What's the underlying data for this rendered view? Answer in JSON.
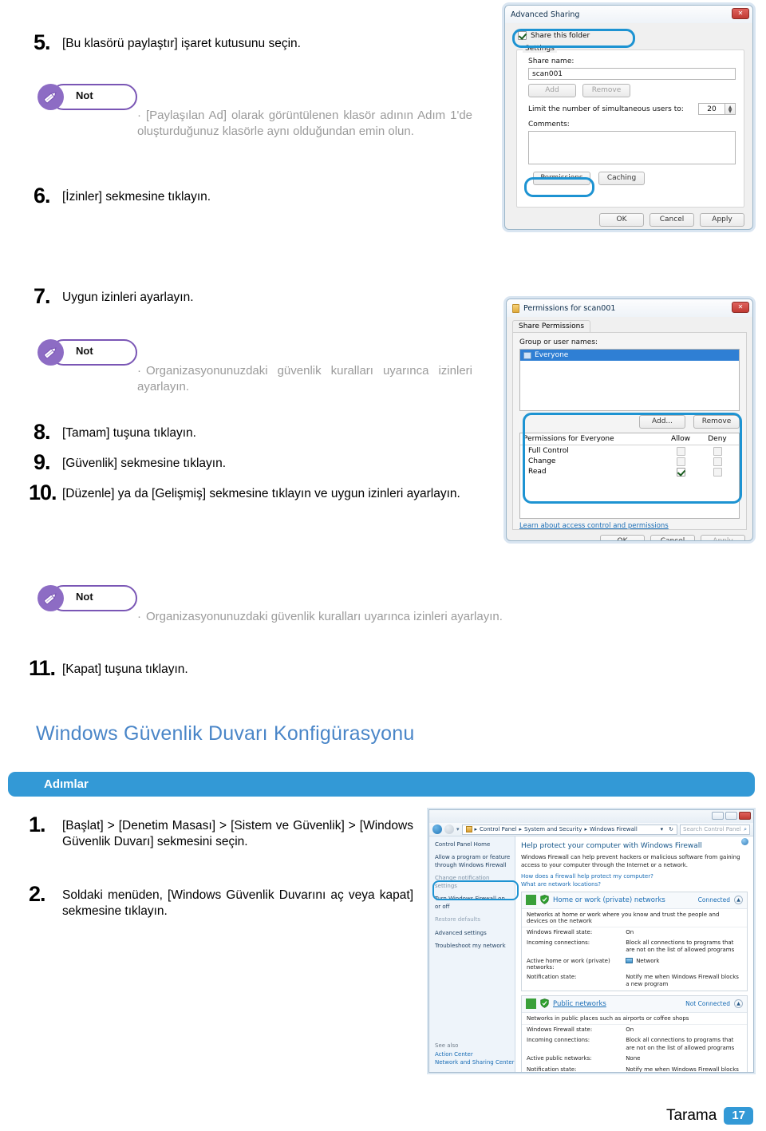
{
  "steps_top": [
    {
      "num": "5.",
      "text": "[Bu klasörü paylaştır] işaret kutusunu seçin."
    },
    {
      "num": "6.",
      "text": "[İzinler] sekmesine tıklayın."
    },
    {
      "num": "7.",
      "text": "Uygun izinleri ayarlayın."
    },
    {
      "num": "8.",
      "text": "[Tamam] tuşuna tıklayın."
    },
    {
      "num": "9.",
      "text": "[Güvenlik] sekmesine tıklayın."
    },
    {
      "num": "10.",
      "text": "[Düzenle] ya da [Gelişmiş] sekmesine tıklayın ve uygun izinleri ayarlayın."
    },
    {
      "num": "11.",
      "text": "[Kapat] tuşuna tıklayın."
    }
  ],
  "notes": {
    "label": "Not",
    "bullet": "·",
    "note1": "[Paylaşılan Ad] olarak görüntülenen klasör adının Adım 1'de oluşturduğunuz klasörle aynı olduğundan emin olun.",
    "note2": "Organizasyonunuzdaki güvenlik kuralları uyarınca izinleri ayarlayın.",
    "note3": "Organizasyonunuzdaki güvenlik kuralları uyarınca izinleri ayarlayın."
  },
  "section": {
    "heading": "Windows Güvenlik Duvarı Konfigürasyonu",
    "steps_bar_label": "Adımlar",
    "steps": [
      {
        "num": "1.",
        "text": "[Başlat] > [Denetim Masası] > [Sistem ve Güvenlik] > [Windows Güvenlik Duvarı] sekmesini seçin."
      },
      {
        "num": "2.",
        "text": "Soldaki menüden, [Windows Güvenlik Duvarını aç veya kapat] sekmesine tıklayın."
      }
    ]
  },
  "footer": {
    "label": "Tarama",
    "page": "17"
  },
  "colors": {
    "accent_blue": "#3399d6",
    "heading_blue": "#4a86c8",
    "note_purple": "#8d6cc4",
    "highlight": "#1d93d2",
    "note_text_gray": "#9b9b9b"
  },
  "dialog_advanced_sharing": {
    "title": "Advanced Sharing",
    "close_label": "✕",
    "share_this_folder": "Share this folder",
    "share_checked": true,
    "settings_group": "Settings",
    "share_name_label": "Share name:",
    "share_name_value": "scan001",
    "add_button": "Add",
    "remove_button": "Remove",
    "limit_label": "Limit the number of simultaneous users to:",
    "limit_value": "20",
    "comments_label": "Comments:",
    "comments_value": "",
    "permissions_button": "Permissions",
    "caching_button": "Caching",
    "ok_button": "OK",
    "cancel_button": "Cancel",
    "apply_button": "Apply"
  },
  "dialog_permissions": {
    "title": "Permissions for scan001",
    "close_label": "✕",
    "tab_label": "Share Permissions",
    "group_label": "Group or user names:",
    "selected_user": "Everyone",
    "add_button": "Add...",
    "remove_button": "Remove",
    "perm_table_header": "Permissions for Everyone",
    "allow_col": "Allow",
    "deny_col": "Deny",
    "rows": [
      {
        "name": "Full Control",
        "allow": false,
        "deny": false
      },
      {
        "name": "Change",
        "allow": false,
        "deny": false
      },
      {
        "name": "Read",
        "allow": true,
        "deny": false
      }
    ],
    "learn_link": "Learn about access control and permissions",
    "ok_button": "OK",
    "cancel_button": "Cancel",
    "apply_button": "Apply"
  },
  "window_firewall": {
    "breadcrumbs": [
      "Control Panel",
      "System and Security",
      "Windows Firewall"
    ],
    "search_placeholder": "Search Control Panel",
    "sidebar": [
      "Control Panel Home",
      "Allow a program or feature through Windows Firewall",
      "Change notification settings",
      "Turn Windows Firewall on or off",
      "Restore defaults",
      "Advanced settings",
      "Troubleshoot my network"
    ],
    "heading": "Help protect your computer with Windows Firewall",
    "paragraph": "Windows Firewall can help prevent hackers or malicious software from gaining access to your computer through the Internet or a network.",
    "link1": "How does a firewall help protect my computer?",
    "link2": "What are network locations?",
    "networks": [
      {
        "name": "Home or work (private) networks",
        "status": "Connected",
        "description": "Networks at home or work where you know and trust the people and devices on the network",
        "rows": [
          {
            "k": "Windows Firewall state:",
            "v": "On"
          },
          {
            "k": "Incoming connections:",
            "v": "Block all connections to programs that are not on the list of allowed programs"
          },
          {
            "k": "Active home or work (private) networks:",
            "v": "Network"
          },
          {
            "k": "Notification state:",
            "v": "Notify me when Windows Firewall blocks a new program"
          }
        ]
      },
      {
        "name": "Public networks",
        "status": "Not Connected",
        "description": "Networks in public places such as airports or coffee shops",
        "rows": [
          {
            "k": "Windows Firewall state:",
            "v": "On"
          },
          {
            "k": "Incoming connections:",
            "v": "Block all connections to programs that are not on the list of allowed programs"
          },
          {
            "k": "Active public networks:",
            "v": "None"
          },
          {
            "k": "Notification state:",
            "v": "Notify me when Windows Firewall blocks a new program"
          }
        ]
      }
    ],
    "see_also_title": "See also",
    "see_also": [
      "Action Center",
      "Network and Sharing Center"
    ]
  }
}
